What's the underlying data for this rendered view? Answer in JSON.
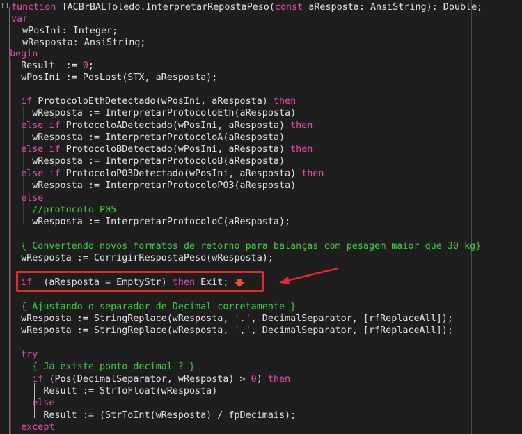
{
  "editor": {
    "lines": [
      [
        [
          "kw",
          "function "
        ],
        [
          "tk",
          "TACBrBALToledo.InterpretarRepostaPeso("
        ],
        [
          "kw",
          "const "
        ],
        [
          "tk",
          "aResposta: AnsiString): Double;"
        ]
      ],
      [
        [
          "kw",
          "var"
        ]
      ],
      [
        [
          "tk",
          "  wPosIni: Integer;"
        ]
      ],
      [
        [
          "tk",
          "  wResposta: AnsiString;"
        ]
      ],
      [
        [
          "kw",
          "begin"
        ]
      ],
      [
        [
          "tk",
          "  Result  := "
        ],
        [
          "num",
          "0"
        ],
        [
          "tk",
          ";"
        ]
      ],
      [
        [
          "tk",
          "  wPosIni := PosLast(STX, aResposta);"
        ]
      ],
      [
        [
          "tk",
          ""
        ]
      ],
      [
        [
          "kw",
          "  if "
        ],
        [
          "tk",
          "ProtocoloEthDetectado(wPosIni, aResposta) "
        ],
        [
          "kw",
          "then"
        ]
      ],
      [
        [
          "tk",
          "    wResposta := InterpretarProtocoloEth(aResposta)"
        ]
      ],
      [
        [
          "kw",
          "  else if "
        ],
        [
          "tk",
          "ProtocoloADetectado(wPosIni, aResposta) "
        ],
        [
          "kw",
          "then"
        ]
      ],
      [
        [
          "tk",
          "    wResposta := InterpretarProtocoloA(aResposta)"
        ]
      ],
      [
        [
          "kw",
          "  else if "
        ],
        [
          "tk",
          "ProtocoloBDetectado(wPosIni, aResposta) "
        ],
        [
          "kw",
          "then"
        ]
      ],
      [
        [
          "tk",
          "    wResposta := InterpretarProtocoloB(aResposta)"
        ]
      ],
      [
        [
          "kw",
          "  else if "
        ],
        [
          "tk",
          "ProtocoloP03Detectado(wPosIni, aResposta) "
        ],
        [
          "kw",
          "then"
        ]
      ],
      [
        [
          "tk",
          "    wResposta := InterpretarProtocoloP03(aResposta)"
        ]
      ],
      [
        [
          "kw",
          "  else"
        ]
      ],
      [
        [
          "cm",
          "    //protocolo P05"
        ]
      ],
      [
        [
          "tk",
          "    wResposta := InterpretarProtocoloC(aResposta);"
        ]
      ],
      [
        [
          "tk",
          ""
        ]
      ],
      [
        [
          "cm",
          "  { Convertendo novos formatos de retorno para balanças com pesagem maior que 30 kg}"
        ]
      ],
      [
        [
          "tk",
          "  wResposta := CorrigirRespostaPeso(wResposta);"
        ]
      ],
      [
        [
          "tk",
          ""
        ]
      ],
      [
        [
          "kw",
          "  if  "
        ],
        [
          "tk",
          "(aResposta = EmptyStr) "
        ],
        [
          "kw",
          "then "
        ],
        [
          "tk",
          "Exit;"
        ]
      ],
      [
        [
          "tk",
          ""
        ]
      ],
      [
        [
          "cm",
          "  { Ajustando o separador de Decimal corretamente }"
        ]
      ],
      [
        [
          "tk",
          "  wResposta := StringReplace(wResposta, "
        ],
        [
          "str",
          "'.'"
        ],
        [
          "tk",
          ", DecimalSeparator, [rfReplaceAll]);"
        ]
      ],
      [
        [
          "tk",
          "  wResposta := StringReplace(wResposta, "
        ],
        [
          "str",
          "','"
        ],
        [
          "tk",
          ", DecimalSeparator, [rfReplaceAll]);"
        ]
      ],
      [
        [
          "tk",
          ""
        ]
      ],
      [
        [
          "kw",
          "  try"
        ]
      ],
      [
        [
          "cm",
          "    { Já existe ponto decimal ? }"
        ]
      ],
      [
        [
          "kw",
          "    if "
        ],
        [
          "tk",
          "(Pos(DecimalSeparator, wResposta) > "
        ],
        [
          "num",
          "0"
        ],
        [
          "tk",
          ") "
        ],
        [
          "kw",
          "then"
        ]
      ],
      [
        [
          "tk",
          "      Result := StrToFloat(wResposta)"
        ]
      ],
      [
        [
          "kw",
          "    else"
        ]
      ],
      [
        [
          "tk",
          "      Result := (StrToInt(wResposta) / fpDecimais);"
        ]
      ],
      [
        [
          "kw",
          "  except"
        ]
      ]
    ],
    "line_tops": [
      2,
      19,
      36,
      53,
      69,
      86,
      103,
      121,
      137,
      154,
      172,
      189,
      206,
      223,
      241,
      258,
      276,
      293,
      310,
      327,
      345,
      362,
      379,
      397,
      414,
      432,
      449,
      466,
      484,
      501,
      518,
      536,
      553,
      570,
      588,
      605
    ],
    "colors": {
      "keyword": "#e64ab7",
      "text": "#e2e2e2",
      "comment": "#3bd13b",
      "background": "#1e1e1e",
      "highlight": "#e22a2a"
    }
  }
}
